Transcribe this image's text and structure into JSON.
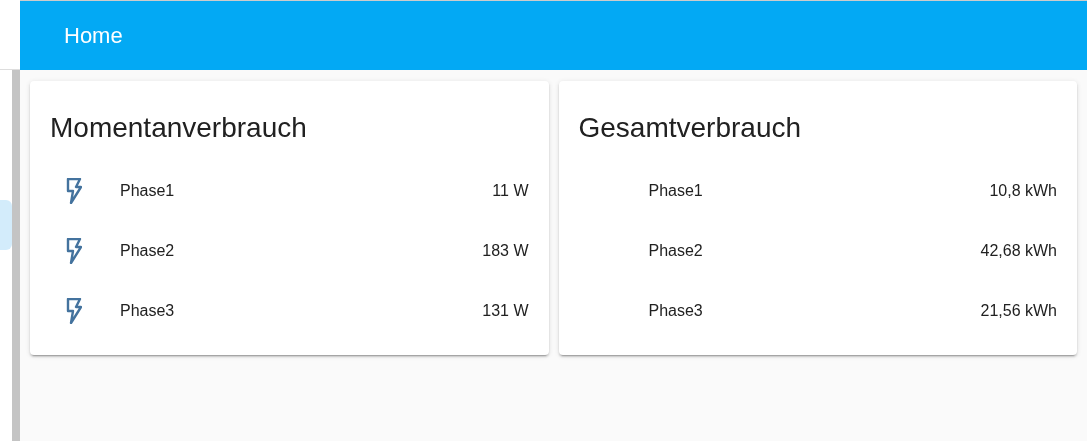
{
  "header": {
    "title": "Home"
  },
  "cards": [
    {
      "title": "Momentanverbrauch",
      "rows": [
        {
          "kind": "icon",
          "name": "Phase1",
          "value": "11 W"
        },
        {
          "kind": "icon",
          "name": "Phase2",
          "value": "183 W"
        },
        {
          "kind": "icon",
          "name": "Phase3",
          "value": "131 W"
        }
      ]
    },
    {
      "title": "Gesamtverbrauch",
      "rows": [
        {
          "kind": "plain",
          "name": "Phase1",
          "value": "10,8 kWh"
        },
        {
          "kind": "plain",
          "name": "Phase2",
          "value": "42,68 kWh"
        },
        {
          "kind": "plain",
          "name": "Phase3",
          "value": "21,56 kWh"
        }
      ]
    }
  ]
}
